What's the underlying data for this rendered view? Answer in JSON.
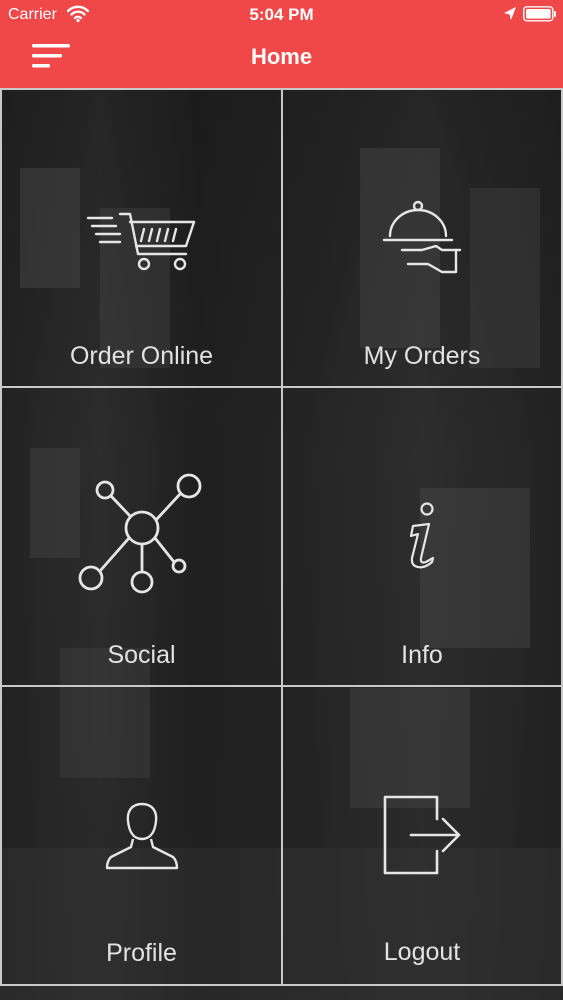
{
  "status_bar": {
    "carrier": "Carrier",
    "time": "5:04 PM"
  },
  "header": {
    "title": "Home",
    "background": "#f04848"
  },
  "tiles": [
    {
      "label": "Order Online",
      "icon": "shopping-cart-icon"
    },
    {
      "label": "My Orders",
      "icon": "serving-cloche-icon"
    },
    {
      "label": "Social",
      "icon": "network-icon"
    },
    {
      "label": "Info",
      "icon": "info-icon"
    },
    {
      "label": "Profile",
      "icon": "user-icon"
    },
    {
      "label": "Logout",
      "icon": "logout-icon"
    }
  ],
  "colors": {
    "tile_border": "#c9c9c9",
    "tile_label": "#e2e2e2",
    "icon_stroke": "#e6e6e6"
  }
}
